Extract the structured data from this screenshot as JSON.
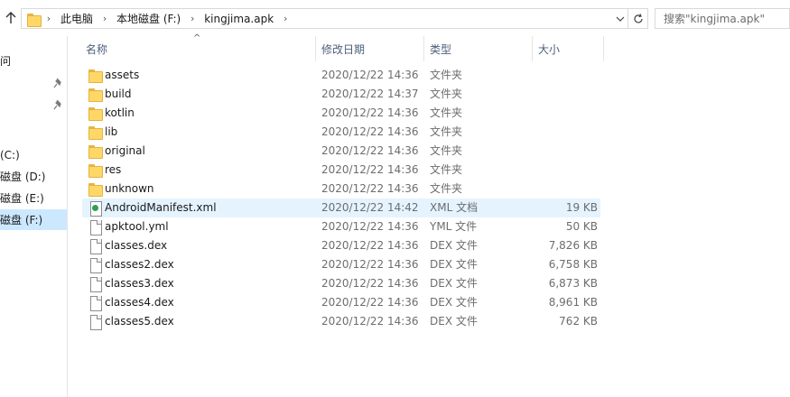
{
  "address": {
    "crumbs": [
      "此电脑",
      "本地磁盘 (F:)",
      "kingjima.apk"
    ],
    "separator": "›"
  },
  "search": {
    "placeholder": "搜索\"kingjima.apk\""
  },
  "nav": {
    "items": [
      {
        "label": "问"
      },
      {
        "label": "(C:)"
      },
      {
        "label": "磁盘 (D:)"
      },
      {
        "label": "磁盘 (E:)"
      },
      {
        "label": "磁盘 (F:)"
      }
    ]
  },
  "columns": {
    "name": "名称",
    "date": "修改日期",
    "type": "类型",
    "size": "大小"
  },
  "files": [
    {
      "name": "assets",
      "date": "2020/12/22 14:36",
      "type": "文件夹",
      "size": "",
      "icon": "folder-icon"
    },
    {
      "name": "build",
      "date": "2020/12/22 14:37",
      "type": "文件夹",
      "size": "",
      "icon": "folder-icon"
    },
    {
      "name": "kotlin",
      "date": "2020/12/22 14:36",
      "type": "文件夹",
      "size": "",
      "icon": "folder-icon"
    },
    {
      "name": "lib",
      "date": "2020/12/22 14:36",
      "type": "文件夹",
      "size": "",
      "icon": "folder-icon"
    },
    {
      "name": "original",
      "date": "2020/12/22 14:36",
      "type": "文件夹",
      "size": "",
      "icon": "folder-icon"
    },
    {
      "name": "res",
      "date": "2020/12/22 14:36",
      "type": "文件夹",
      "size": "",
      "icon": "folder-icon"
    },
    {
      "name": "unknown",
      "date": "2020/12/22 14:36",
      "type": "文件夹",
      "size": "",
      "icon": "folder-icon"
    },
    {
      "name": "AndroidManifest.xml",
      "date": "2020/12/22 14:42",
      "type": "XML 文档",
      "size": "19 KB",
      "icon": "xml-file-icon"
    },
    {
      "name": "apktool.yml",
      "date": "2020/12/22 14:36",
      "type": "YML 文件",
      "size": "50 KB",
      "icon": "file-icon"
    },
    {
      "name": "classes.dex",
      "date": "2020/12/22 14:36",
      "type": "DEX 文件",
      "size": "7,826 KB",
      "icon": "file-icon"
    },
    {
      "name": "classes2.dex",
      "date": "2020/12/22 14:36",
      "type": "DEX 文件",
      "size": "6,758 KB",
      "icon": "file-icon"
    },
    {
      "name": "classes3.dex",
      "date": "2020/12/22 14:36",
      "type": "DEX 文件",
      "size": "6,873 KB",
      "icon": "file-icon"
    },
    {
      "name": "classes4.dex",
      "date": "2020/12/22 14:36",
      "type": "DEX 文件",
      "size": "8,961 KB",
      "icon": "file-icon"
    },
    {
      "name": "classes5.dex",
      "date": "2020/12/22 14:36",
      "type": "DEX 文件",
      "size": "762 KB",
      "icon": "file-icon"
    }
  ],
  "colors": {
    "selected": "#cce8ff",
    "hover": "#e5f3ff",
    "header_text": "#4c607a"
  }
}
